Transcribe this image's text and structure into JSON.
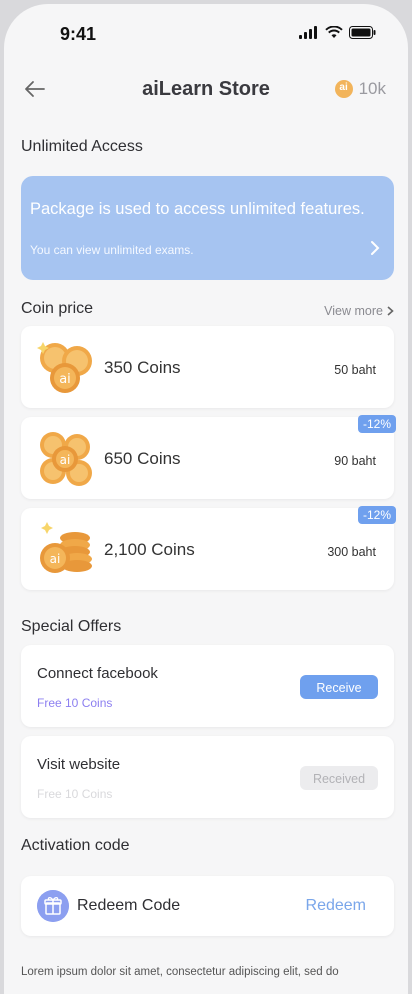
{
  "status_bar": {
    "time": "9:41"
  },
  "header": {
    "title": "aiLearn Store",
    "balance": "10k",
    "coin_glyph": "ai"
  },
  "unlimited": {
    "section_title": "Unlimited Access",
    "banner_title": "Package is used to access unlimited features.",
    "banner_subtitle": "You can view unlimited exams."
  },
  "coin_price": {
    "section_title": "Coin price",
    "view_more": "View more",
    "items": [
      {
        "label": "350 Coins",
        "price": "50 baht",
        "discount": ""
      },
      {
        "label": "650 Coins",
        "price": "90 baht",
        "discount": "-12%"
      },
      {
        "label": "2,100 Coins",
        "price": "300 baht",
        "discount": "-12%"
      }
    ]
  },
  "special_offers": {
    "section_title": "Special Offers",
    "items": [
      {
        "name": "Connect facebook",
        "reward": "Free 10 Coins",
        "button": "Receive"
      },
      {
        "name": "Visit website",
        "reward": "Free 10 Coins",
        "button": "Received"
      }
    ]
  },
  "activation": {
    "section_title": "Activation code",
    "label": "Redeem Code",
    "action": "Redeem"
  },
  "footer": {
    "text": "Lorem ipsum dolor sit amet, consectetur adipiscing elit, sed do"
  },
  "colors": {
    "accent": "#6fa0ee",
    "banner": "#a6c4f1",
    "reward_active": "#8c7ff0",
    "coin": "#f2b45b"
  }
}
